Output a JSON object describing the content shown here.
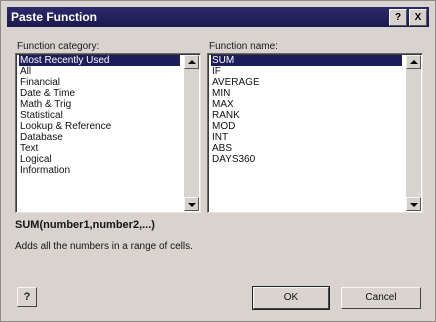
{
  "dialog": {
    "title": "Paste Function",
    "help_button": "?",
    "close_button": "X"
  },
  "category": {
    "label": "Function category:",
    "items": [
      {
        "label": "Most Recently Used",
        "selected": true
      },
      {
        "label": "All",
        "selected": false
      },
      {
        "label": "Financial",
        "selected": false
      },
      {
        "label": "Date & Time",
        "selected": false
      },
      {
        "label": "Math & Trig",
        "selected": false
      },
      {
        "label": "Statistical",
        "selected": false
      },
      {
        "label": "Lookup & Reference",
        "selected": false
      },
      {
        "label": "Database",
        "selected": false
      },
      {
        "label": "Text",
        "selected": false
      },
      {
        "label": "Logical",
        "selected": false
      },
      {
        "label": "Information",
        "selected": false
      }
    ]
  },
  "function": {
    "label": "Function name:",
    "items": [
      {
        "label": "SUM",
        "selected": true
      },
      {
        "label": "IF",
        "selected": false
      },
      {
        "label": "AVERAGE",
        "selected": false
      },
      {
        "label": "MIN",
        "selected": false
      },
      {
        "label": "MAX",
        "selected": false
      },
      {
        "label": "RANK",
        "selected": false
      },
      {
        "label": "MOD",
        "selected": false
      },
      {
        "label": "INT",
        "selected": false
      },
      {
        "label": "ABS",
        "selected": false
      },
      {
        "label": "DAYS360",
        "selected": false
      }
    ]
  },
  "syntax": "SUM(number1,number2,...)",
  "description": "Adds all the numbers in a range of cells.",
  "buttons": {
    "help": "?",
    "ok": "OK",
    "cancel": "Cancel"
  }
}
